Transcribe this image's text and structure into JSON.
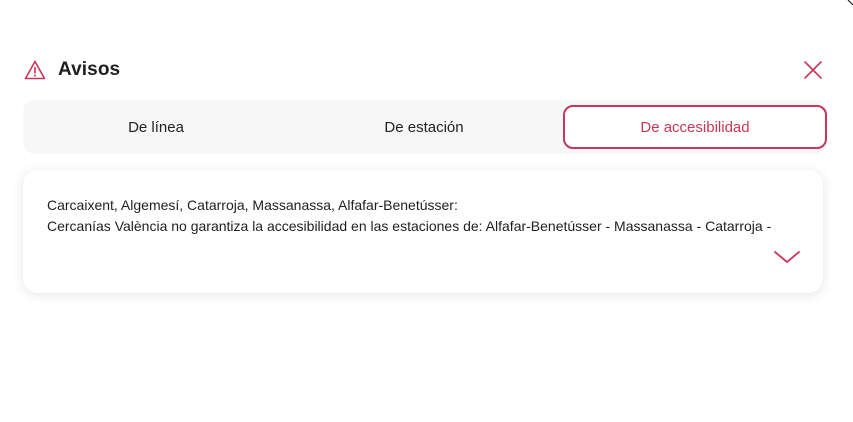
{
  "header": {
    "title": "Avisos",
    "warning_icon": "warning-triangle-icon",
    "close_icon": "close-icon"
  },
  "tabs": [
    {
      "label": "De línea",
      "active": false
    },
    {
      "label": "De estación",
      "active": false
    },
    {
      "label": "De accesibilidad",
      "active": true
    }
  ],
  "notice": {
    "stations": "Carcaixent, Algemesí, Catarroja, Massanassa, Alfafar-Benetússer:",
    "message": "Cercanías València no garantiza la accesibilidad en las estaciones de: Alfafar-Benetússer - Massanassa - Catarroja -",
    "expand_icon": "chevron-down-icon"
  },
  "colors": {
    "accent": "#c8375a",
    "tab_bar_bg": "#f7f7f7",
    "text": "#1f1f1f"
  }
}
